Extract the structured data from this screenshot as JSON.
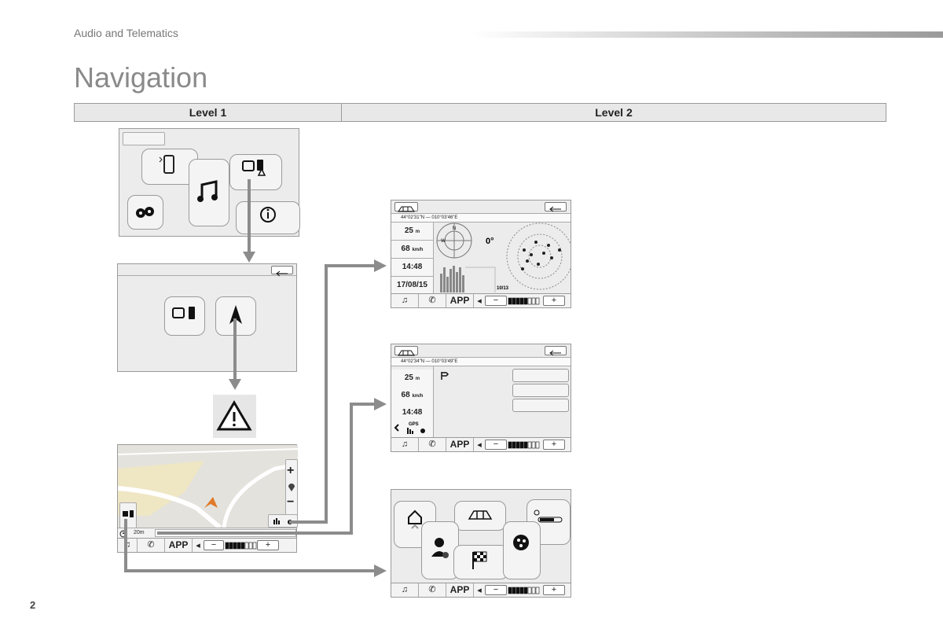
{
  "header": {
    "section": "Audio and Telematics",
    "title": "Navigation"
  },
  "levels": {
    "level1": "Level 1",
    "level2": "Level 2"
  },
  "screen_b": {
    "coords": "44°02'31\"N — 010°03'46\"E",
    "distance": "25",
    "distance_unit": "m",
    "speed": "68",
    "speed_unit": "km/h",
    "time": "14:48",
    "date": "17/08/15",
    "heading": "0°",
    "compass_n": "N",
    "compass_w": "W",
    "satellites": "10/13"
  },
  "screen_c": {
    "coords": "44°02'34\"N — 010°03'49\"E",
    "distance": "25",
    "distance_unit": "m",
    "speed": "68",
    "speed_unit": "km/h",
    "time": "14:48",
    "gps_label": "GPS"
  },
  "map_view": {
    "scale": "20m"
  },
  "footer": {
    "app_label": "APP",
    "minus": "−",
    "plus": "+"
  },
  "page_number": "2"
}
